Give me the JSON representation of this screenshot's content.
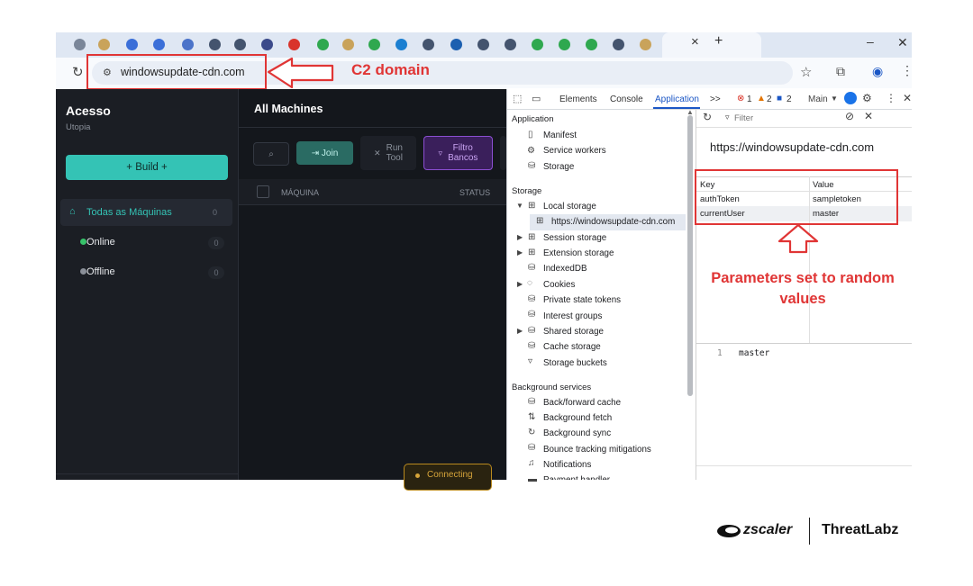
{
  "browser": {
    "url": "windowsupdate-cdn.com",
    "tab_close": "×",
    "tab_new": "+"
  },
  "annotations": {
    "c2_label": "C2 domain",
    "params_label": "Parameters set to random values"
  },
  "app": {
    "brand_title": "Acesso",
    "brand_subtitle": "Utopia",
    "build_button": "+ Build +",
    "nav": [
      {
        "label": "Todas as Máquinas",
        "count": "0"
      },
      {
        "label": "Online",
        "count": "0",
        "color": "#37c26a"
      },
      {
        "label": "Offline",
        "count": "0",
        "color": "#8a8f98"
      }
    ],
    "main_title": "All Machines",
    "toolbar": {
      "join": "Join",
      "run_tool_line1": "Run",
      "run_tool_line2": "Tool",
      "filter_line1": "Filtro",
      "filter_line2": "Bancos"
    },
    "table_headers": {
      "machine": "MÁQUINA",
      "status": "STATUS"
    },
    "connecting": "Connecting"
  },
  "devtools": {
    "tabs": [
      "Elements",
      "Console",
      "Application"
    ],
    "more": ">>",
    "errors": "1",
    "warnings": "2",
    "issues": "2",
    "context": "Main",
    "sections": {
      "application": "Application",
      "storage": "Storage",
      "background": "Background services"
    },
    "application_items": [
      "Manifest",
      "Service workers",
      "Storage"
    ],
    "storage_items": [
      "Local storage",
      "https://windowsupdate-cdn.com",
      "Session storage",
      "Extension storage",
      "IndexedDB",
      "Cookies",
      "Private state tokens",
      "Interest groups",
      "Shared storage",
      "Cache storage",
      "Storage buckets"
    ],
    "background_items": [
      "Back/forward cache",
      "Background fetch",
      "Background sync",
      "Bounce tracking mitigations",
      "Notifications",
      "Payment handler"
    ],
    "filter_placeholder": "Filter",
    "origin": "https://windowsupdate-cdn.com",
    "kv_headers": {
      "key": "Key",
      "value": "Value"
    },
    "kv_rows": [
      {
        "key": "authToken",
        "value": "sampletoken"
      },
      {
        "key": "currentUser",
        "value": "master"
      }
    ],
    "preview": {
      "line": "1",
      "text": "master"
    }
  },
  "footer": {
    "brand": "zscaler",
    "product": "ThreatLabz"
  }
}
